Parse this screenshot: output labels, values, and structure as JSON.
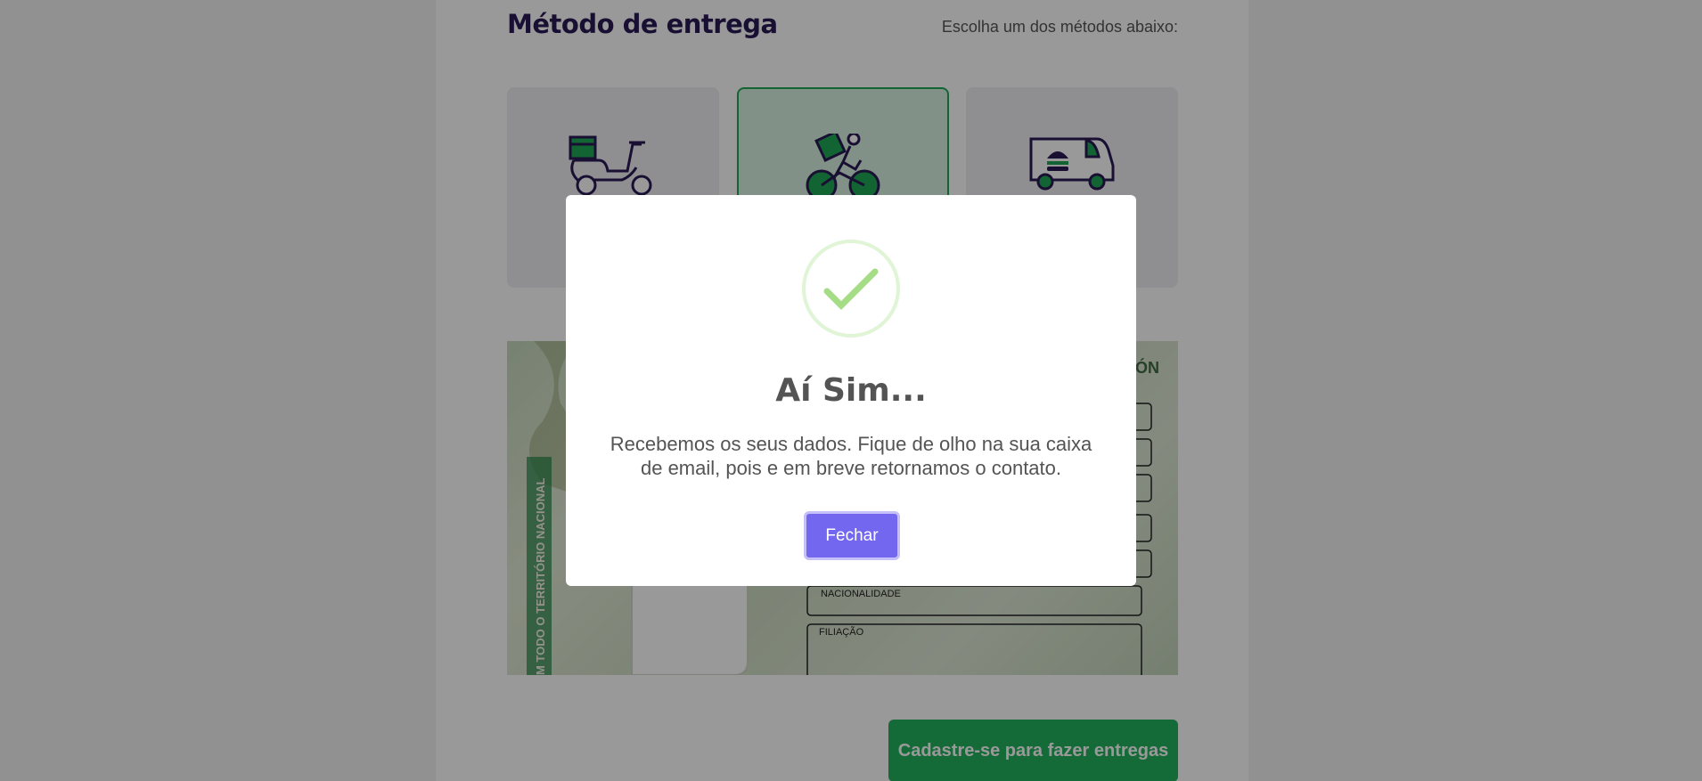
{
  "delivery": {
    "title": "Método de entrega",
    "hint": "Escolha um dos métodos abaixo:",
    "methods": [
      {
        "icon": "scooter-icon",
        "selected": false
      },
      {
        "icon": "bicycle-courier-icon",
        "selected": true
      },
      {
        "icon": "food-truck-icon",
        "selected": false
      }
    ]
  },
  "document": {
    "labels": [
      "NACIONALIDADE",
      "FILIAÇÃO"
    ],
    "side_text": "M TODO O TERRITÓRIO NACIONAL",
    "corner_text": "ÓN"
  },
  "register_label": "Cadastre-se para fazer entregas",
  "modal": {
    "title": "Aí Sim...",
    "message": "Recebemos os seus dados. Fique de olho na sua caixa de email, pois e em breve retornamos o contato.",
    "close_label": "Fechar"
  },
  "colors": {
    "brand_dark": "#2b1a55",
    "accent_green": "#23b35e",
    "button_purple": "#7367f0",
    "success_check": "#a5dc86"
  }
}
